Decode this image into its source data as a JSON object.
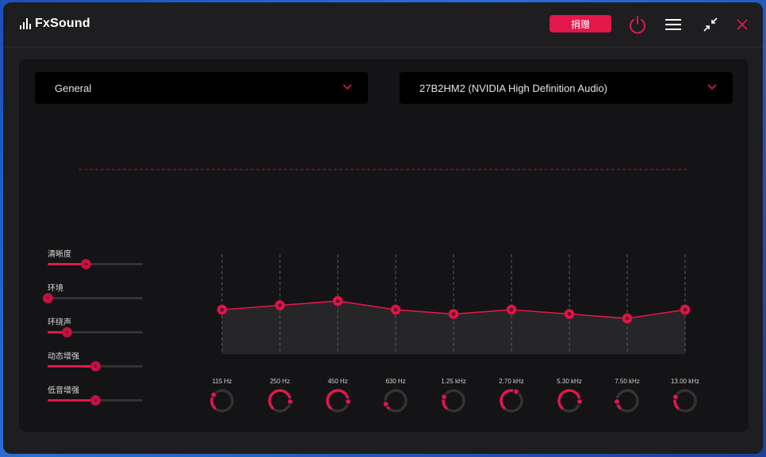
{
  "app": {
    "name": "FxSound"
  },
  "titlebar": {
    "donate_label": "捐赠",
    "icons": [
      "power-icon",
      "menu-icon",
      "minimize-icon",
      "close-icon"
    ]
  },
  "colors": {
    "accent": "#e3174a",
    "background": "#1e1e20",
    "panel": "#141416"
  },
  "preset": {
    "selected": "General"
  },
  "output_device": {
    "selected": "27B2HM2 (NVIDIA High Definition Audio)"
  },
  "effects": [
    {
      "label": "清晰度",
      "value": 0.4
    },
    {
      "label": "环境",
      "value": 0.0
    },
    {
      "label": "环绕声",
      "value": 0.2
    },
    {
      "label": "动态增强",
      "value": 0.5
    },
    {
      "label": "低音增强",
      "value": 0.5
    }
  ],
  "equalizer": {
    "bands": [
      {
        "label": "115 Hz",
        "gain": 0.0
      },
      {
        "label": "250 Hz",
        "gain": 0.5
      },
      {
        "label": "450 Hz",
        "gain": 1.0
      },
      {
        "label": "630 Hz",
        "gain": 0.0
      },
      {
        "label": "1.25 kHz",
        "gain": -0.5
      },
      {
        "label": "2.70 kHz",
        "gain": 0.0
      },
      {
        "label": "5.30 kHz",
        "gain": -0.5
      },
      {
        "label": "7.50 kHz",
        "gain": -1.0
      },
      {
        "label": "13.00 kHz",
        "gain": 0.0
      }
    ],
    "knob_levels": [
      0.3,
      0.85,
      0.85,
      0.1,
      0.25,
      0.6,
      0.85,
      0.15,
      0.25
    ]
  }
}
